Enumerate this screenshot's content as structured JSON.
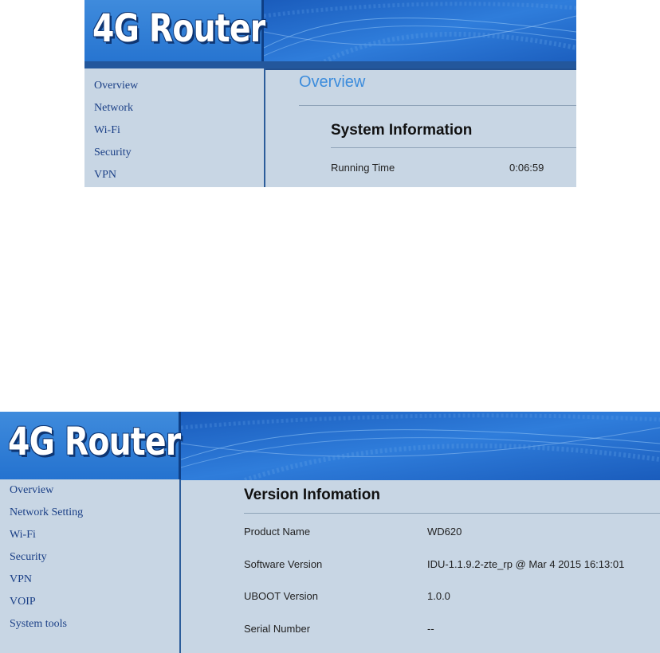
{
  "panel1": {
    "logo": "4G Router",
    "nav": [
      "Overview",
      "Network",
      "Wi-Fi",
      "Security",
      "VPN"
    ],
    "page_title": "Overview",
    "section_title": "System Information",
    "rows": [
      {
        "label": "Running Time",
        "value": "0:06:59"
      }
    ]
  },
  "panel2": {
    "logo": "4G Router",
    "nav": [
      "Overview",
      "Network Setting",
      "Wi-Fi",
      "Security",
      "VPN",
      "VOIP",
      "System tools"
    ],
    "section_title": "Version Infomation",
    "rows": [
      {
        "label": "Product Name",
        "value": "WD620"
      },
      {
        "label": "Software Version",
        "value": "IDU-1.1.9.2-zte_rp @ Mar 4 2015 16:13:01"
      },
      {
        "label": "UBOOT Version",
        "value": "1.0.0"
      },
      {
        "label": "Serial Number",
        "value": "--"
      }
    ]
  },
  "colors": {
    "banner": "#1d64c4",
    "sidebar_bg": "#c8d6e4",
    "nav_link": "#1a3f86",
    "heading_blue": "#3c8cdc"
  }
}
